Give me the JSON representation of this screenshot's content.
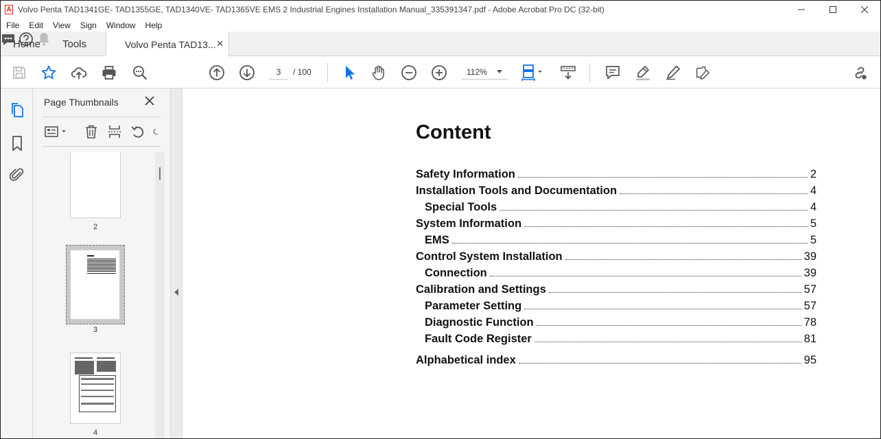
{
  "window": {
    "title": "Volvo Penta TAD1341GE- TAD1355GE, TAD1340VE- TAD1365VE EMS 2 Industrial Engines Installation Manual_335391347.pdf - Adobe Acrobat Pro DC (32-bit)"
  },
  "menu": [
    "File",
    "Edit",
    "View",
    "Sign",
    "Window",
    "Help"
  ],
  "tabs": {
    "home": "Home",
    "tools": "Tools",
    "document": "Volvo Penta TAD13...",
    "close_glyph": "✕"
  },
  "toolbar": {
    "current_page": "3",
    "page_total": "/ 100",
    "zoom": "112%"
  },
  "thumbnails": {
    "header": "Page Thumbnails",
    "close_glyph": "✕",
    "pages": [
      {
        "label": "2"
      },
      {
        "label": "3",
        "selected": true
      },
      {
        "label": "4"
      }
    ]
  },
  "document": {
    "title": "Content",
    "toc": [
      {
        "label": "Safety Information",
        "page": "2",
        "level": 1
      },
      {
        "label": "Installation Tools and Documentation",
        "page": "4",
        "level": 1
      },
      {
        "label": "Special Tools",
        "page": "4",
        "level": 2
      },
      {
        "label": "System Information",
        "page": "5",
        "level": 1
      },
      {
        "label": "EMS",
        "page": "5",
        "level": 2
      },
      {
        "label": "Control System Installation",
        "page": "39",
        "level": 1
      },
      {
        "label": "Connection",
        "page": "39",
        "level": 2
      },
      {
        "label": "Calibration and Settings",
        "page": "57",
        "level": 1
      },
      {
        "label": "Parameter Setting",
        "page": "57",
        "level": 2
      },
      {
        "label": "Diagnostic Function",
        "page": "78",
        "level": 2
      },
      {
        "label": "Fault Code Register",
        "page": "81",
        "level": 2
      },
      {
        "label": "Alphabetical index",
        "page": "95",
        "level": 1,
        "gap": true
      }
    ]
  },
  "colors": {
    "accent_blue": "#1473e6",
    "icon_gray": "#555555",
    "brand_red": "#d7281f"
  }
}
